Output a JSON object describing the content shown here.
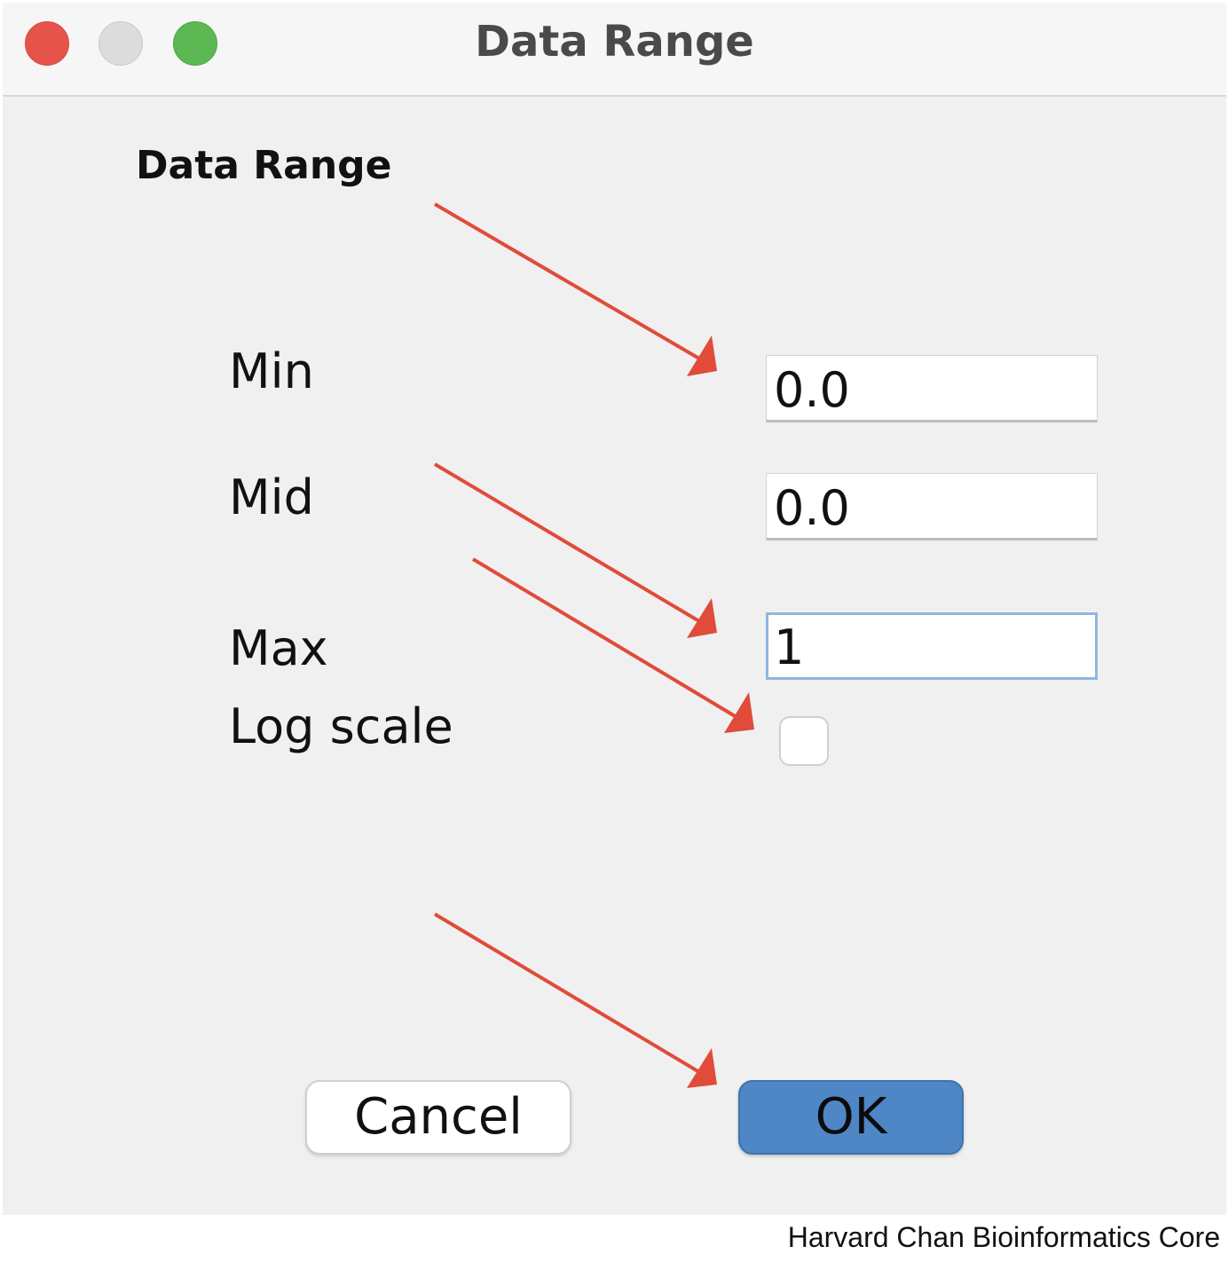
{
  "window": {
    "title": "Data Range",
    "traffic_lights": [
      "close",
      "minimize",
      "zoom"
    ]
  },
  "dialog": {
    "section_title": "Data Range",
    "fields": [
      {
        "label": "Min",
        "value": "0.0"
      },
      {
        "label": "Mid",
        "value": "0.0"
      },
      {
        "label": "Max",
        "value": "1",
        "focused": true
      }
    ],
    "log_scale": {
      "label": "Log scale",
      "checked": false
    },
    "buttons": {
      "cancel": "Cancel",
      "ok": "OK"
    }
  },
  "annotations": {
    "arrow_color": "#e04b3a",
    "arrow_count": 4
  },
  "colors": {
    "ok_button": "#4f86c6",
    "focus_ring": "#8fb6e0",
    "close": "#e5534b",
    "minimize": "#dcdcdc",
    "zoom": "#5bb852"
  },
  "credit": "Harvard Chan Bioinformatics Core"
}
